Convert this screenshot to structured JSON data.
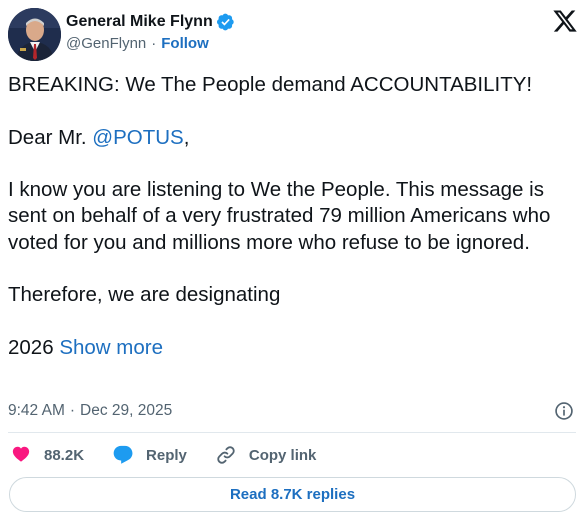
{
  "author": {
    "name": "General Mike Flynn",
    "handle": "@GenFlynn",
    "separator": "·",
    "follow_label": "Follow",
    "verified_color": "#1d9bf0"
  },
  "post": {
    "line1": "BREAKING: We The People demand ACCOUNTABILITY!",
    "line2_prefix": "Dear Mr. ",
    "line2_mention": "@POTUS",
    "line2_suffix": ",",
    "para3": "I know you are listening to We the People. This message is sent on behalf of a very frustrated 79 million Americans who voted for you and millions more who refuse to be ignored.",
    "para4": "Therefore, we are designating",
    "para5_prefix": "2026 ",
    "show_more_label": "Show more"
  },
  "meta": {
    "time": "9:42 AM",
    "separator": "·",
    "date": "Dec 29, 2025"
  },
  "actions": {
    "likes": "88.2K",
    "reply_label": "Reply",
    "copy_label": "Copy link"
  },
  "footer": {
    "read_replies_label": "Read 8.7K replies"
  },
  "colors": {
    "link": "#1d6fc0",
    "like": "#f91880",
    "reply_icon": "#1d9bf0",
    "muted": "#536471"
  },
  "icons": {
    "platform": "x-logo-icon",
    "verified": "verified-badge-icon",
    "info": "info-icon",
    "like": "heart-icon",
    "reply": "speech-bubble-icon",
    "copy": "link-icon"
  }
}
